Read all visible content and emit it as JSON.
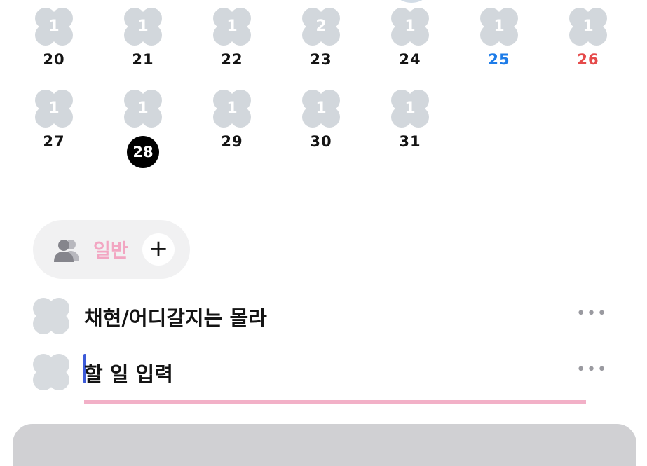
{
  "calendar": {
    "row1": [
      {
        "count": "1",
        "day": "20",
        "tone": "normal"
      },
      {
        "count": "1",
        "day": "21",
        "tone": "normal"
      },
      {
        "count": "1",
        "day": "22",
        "tone": "normal"
      },
      {
        "count": "2",
        "day": "23",
        "tone": "normal"
      },
      {
        "count": "1",
        "day": "24",
        "tone": "normal"
      },
      {
        "count": "1",
        "day": "25",
        "tone": "saturday"
      },
      {
        "count": "1",
        "day": "26",
        "tone": "sunday"
      }
    ],
    "row2": [
      {
        "count": "1",
        "day": "27",
        "tone": "normal"
      },
      {
        "count": "1",
        "day": "28",
        "tone": "today"
      },
      {
        "count": "1",
        "day": "29",
        "tone": "normal"
      },
      {
        "count": "1",
        "day": "30",
        "tone": "normal"
      },
      {
        "count": "1",
        "day": "31",
        "tone": "normal"
      }
    ]
  },
  "category": {
    "icon": "people-icon",
    "label": "일반",
    "add_label": "+"
  },
  "todos": [
    {
      "text": "채현/어디갈지는 몰라",
      "more": "•••"
    }
  ],
  "new_todo": {
    "placeholder": "할 일 입력",
    "more": "•••"
  },
  "colors": {
    "saturday": "#1e7ce8",
    "sunday": "#e54a4a",
    "accent_pink": "#f2a6c2",
    "clover_gray": "#d2d7dc"
  }
}
